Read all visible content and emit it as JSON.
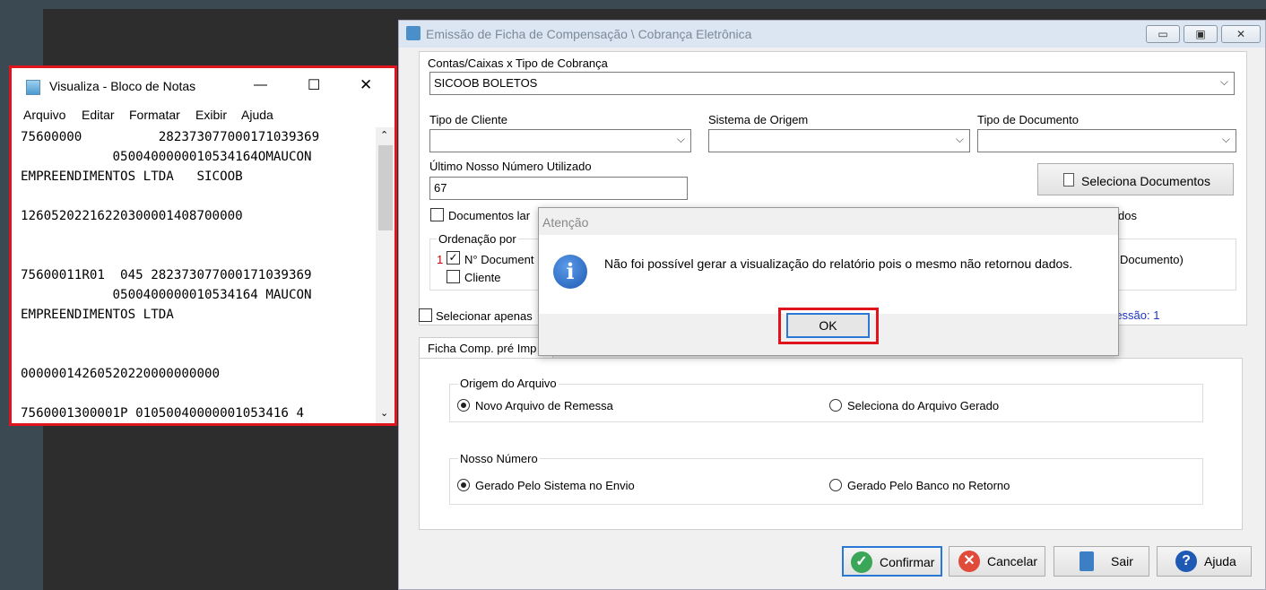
{
  "notepad": {
    "title": "Visualiza - Bloco de Notas",
    "window_controls": {
      "minimize": "—",
      "maximize": "☐",
      "close": "✕"
    },
    "menu": [
      "Arquivo",
      "Editar",
      "Formatar",
      "Exibir",
      "Ajuda"
    ],
    "lines": [
      "75600000          282373077000171039369",
      "            0500400000010534164OMAUCON",
      "EMPREENDIMENTOS LTDA   SICOOB",
      "",
      "12605202216220300001408700000",
      "",
      "",
      "75600011R01  045 282373077000171039369",
      "            0500400000010534164 MAUCON",
      "EMPREENDIMENTOS LTDA",
      "",
      "",
      "00000014260520220000000000",
      "",
      "7560001300001P 01050040000001053416 4"
    ]
  },
  "dialog": {
    "title": "Emissão de Ficha de Compensação \\ Cobrança Eletrônica",
    "contas_label": "Contas/Caixas x Tipo de Cobrança",
    "contas_value": "SICOOB  BOLETOS",
    "tipo_cliente_label": "Tipo de Cliente",
    "tipo_cliente_value": "",
    "sistema_origem_label": "Sistema de Origem",
    "sistema_origem_value": "",
    "tipo_documento_label": "Tipo de Documento",
    "tipo_documento_value": "",
    "ultimo_nosso_numero_label": "Último Nosso Número Utilizado",
    "ultimo_nosso_numero_value": "67",
    "seleciona_documentos_label": "Seleciona Documentos",
    "documentos_label_partial": "Documentos lar",
    "dos_partial": "dos",
    "ordenacao_label": "Ordenação por",
    "ordenacao_num": "1",
    "ordenacao_doc_partial": "N° Document",
    "ordenacao_cliente": "Cliente",
    "documento_partial": "Documento)",
    "selecionar_apenas_partial": "Selecionar apenas",
    "impressao_partial": "ressão: 1",
    "tab_label_partial": "Ficha Comp. pré Imp",
    "origem_arquivo_label": "Origem do Arquivo",
    "novo_arquivo_label": "Novo Arquivo de Remessa",
    "seleciona_arquivo_label": "Seleciona do Arquivo Gerado",
    "nosso_numero_label": "Nosso Número",
    "gerado_sistema_label": "Gerado Pelo Sistema no Envio",
    "gerado_banco_label": "Gerado Pelo Banco  no Retorno",
    "buttons": {
      "confirmar": "Confirmar",
      "cancelar": "Cancelar",
      "sair": "Sair",
      "ajuda": "Ajuda"
    },
    "window_controls": {
      "minimize": "▭",
      "maximize": "▣",
      "close": "✕"
    }
  },
  "alert": {
    "title": "Atenção",
    "message": "Não foi possível gerar a visualização do relatório pois o mesmo não retornou dados.",
    "ok_label": "OK"
  },
  "colors": {
    "highlight_red": "#e0141d",
    "info_blue": "#1e5ab4",
    "link_blue": "#1f33c4"
  }
}
